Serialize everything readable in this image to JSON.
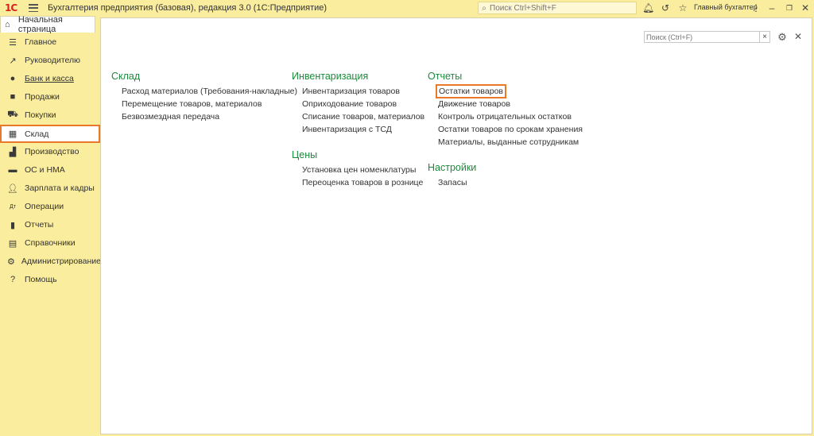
{
  "titlebar": {
    "logo": "1С",
    "title": "Бухгалтерия предприятия (базовая), редакция 3.0  (1С:Предприятие)",
    "search_placeholder": "Поиск Ctrl+Shift+F",
    "user": "Главный бухгалтер"
  },
  "tabs": {
    "home_label": "Начальная страница"
  },
  "sidebar": {
    "items": [
      {
        "label": "Главное",
        "icon": "menu-lines-icon"
      },
      {
        "label": "Руководителю",
        "icon": "trend-icon"
      },
      {
        "label": "Банк и касса",
        "icon": "coin-icon"
      },
      {
        "label": "Продажи",
        "icon": "bag-icon"
      },
      {
        "label": "Покупки",
        "icon": "cart-icon"
      },
      {
        "label": "Склад",
        "icon": "warehouse-grid-icon"
      },
      {
        "label": "Производство",
        "icon": "factory-icon"
      },
      {
        "label": "ОС и НМА",
        "icon": "truck-icon"
      },
      {
        "label": "Зарплата и кадры",
        "icon": "person-icon"
      },
      {
        "label": "Операции",
        "icon": "dt-kt-icon"
      },
      {
        "label": "Отчеты",
        "icon": "bar-chart-icon"
      },
      {
        "label": "Справочники",
        "icon": "book-icon"
      },
      {
        "label": "Администрирование",
        "icon": "gear-icon"
      },
      {
        "label": "Помощь",
        "icon": "question-icon"
      }
    ],
    "active_index": 5
  },
  "main": {
    "search_placeholder": "Поиск (Ctrl+F)",
    "clear_label": "×",
    "sections": {
      "sklad": {
        "title": "Склад",
        "links": [
          "Расход материалов (Требования-накладные)",
          "Перемещение товаров, материалов",
          "Безвозмездная передача"
        ]
      },
      "inventory": {
        "title": "Инвентаризация",
        "links": [
          "Инвентаризация товаров",
          "Оприходование товаров",
          "Списание товаров, материалов",
          "Инвентаризация с ТСД"
        ]
      },
      "prices": {
        "title": "Цены",
        "links": [
          "Установка цен номенклатуры",
          "Переоценка товаров в рознице"
        ]
      },
      "reports": {
        "title": "Отчеты",
        "links": [
          "Остатки товаров",
          "Движение товаров",
          "Контроль отрицательных остатков",
          "Остатки товаров по срокам хранения",
          "Материалы, выданные сотрудникам"
        ]
      },
      "settings": {
        "title": "Настройки",
        "links": [
          "Запасы"
        ]
      }
    }
  },
  "colors": {
    "panel_bg": "#fbed9e",
    "section_title": "#1c8a3c",
    "highlight": "#e9782a",
    "logo": "#d8221e"
  }
}
